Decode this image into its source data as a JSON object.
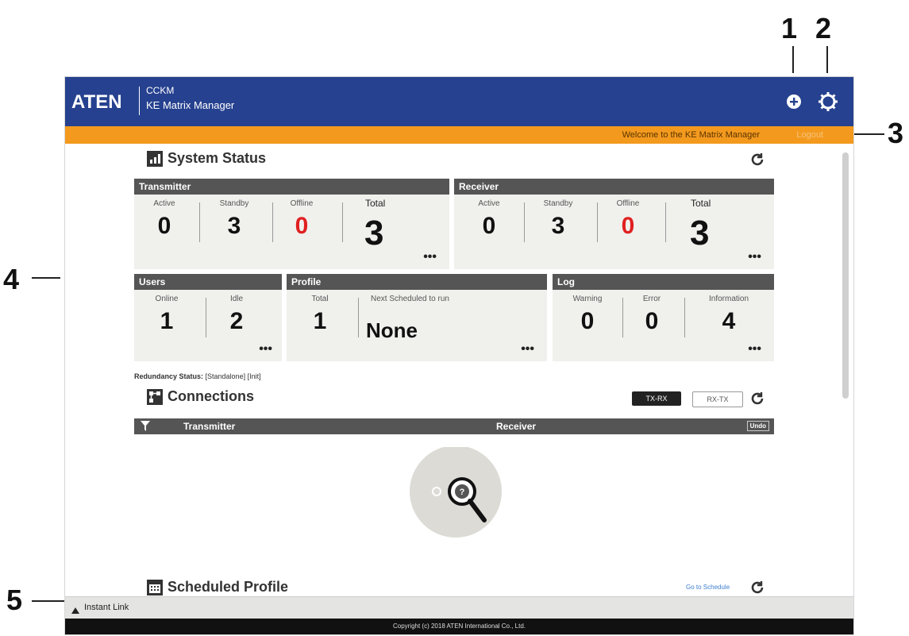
{
  "callouts": [
    "1",
    "2",
    "3",
    "4",
    "5"
  ],
  "header": {
    "logo": "ATEN",
    "product_line": "CCKM",
    "product_name": "KE Matrix Manager"
  },
  "welcome": {
    "message": "Welcome to the KE Matrix Manager",
    "link": "Logout"
  },
  "system_status": {
    "title": "System Status",
    "transmitter": {
      "label": "Transmitter",
      "active_label": "Active",
      "active": "0",
      "standby_label": "Standby",
      "standby": "3",
      "offline_label": "Offline",
      "offline": "0",
      "total_label": "Total",
      "total": "3"
    },
    "receiver": {
      "label": "Receiver",
      "active_label": "Active",
      "active": "0",
      "standby_label": "Standby",
      "standby": "3",
      "offline_label": "Offline",
      "offline": "0",
      "total_label": "Total",
      "total": "3"
    },
    "users": {
      "label": "Users",
      "online_label": "Online",
      "online": "1",
      "idle_label": "Idle",
      "idle": "2"
    },
    "profile": {
      "label": "Profile",
      "total_label": "Total",
      "total": "1",
      "next_label": "Next Scheduled to run",
      "next": "None"
    },
    "log": {
      "label": "Log",
      "warning_label": "Warning",
      "warning": "0",
      "error_label": "Error",
      "error": "0",
      "information_label": "Information",
      "information": "4"
    },
    "more": "•••"
  },
  "redundancy": {
    "label": "Redundancy Status:",
    "value": "[Standalone] [Init]"
  },
  "connections": {
    "title": "Connections",
    "tx_rx": "TX-RX",
    "rx_tx": "RX-TX",
    "col_transmitter": "Transmitter",
    "col_receiver": "Receiver",
    "undo": "Undo"
  },
  "scheduled_profile": {
    "title": "Scheduled Profile",
    "go_link": "Go to Schedule"
  },
  "instant_link": "Instant Link",
  "footer": "Copyright (c) 2018 ATEN International Co., Ltd.",
  "colors": {
    "header_bg": "#26418f",
    "welcome_bg": "#f39a1e",
    "panel_head": "#555555",
    "panel_bg": "#f0f0ed",
    "offline_red": "#e02020"
  }
}
